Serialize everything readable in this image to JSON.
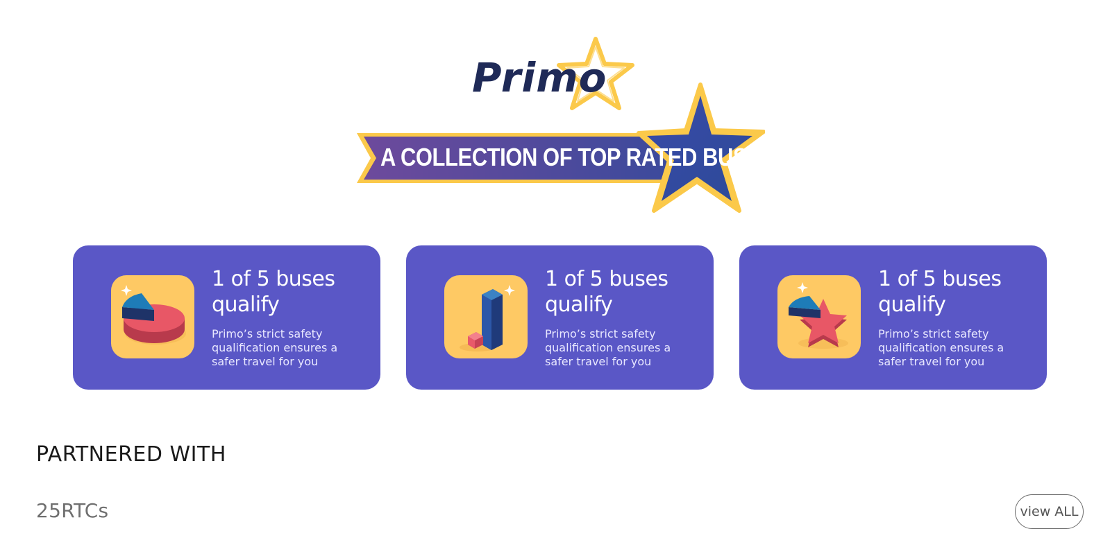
{
  "brand": {
    "logo_text": "Primo",
    "tagline": "A COLLECTION OF TOP RATED BUSES"
  },
  "colors": {
    "card_bg": "#5a57c6",
    "icon_bg": "#fec964",
    "star_gold": "#fbc94a",
    "ribbon_start": "#6d4a9c",
    "ribbon_end": "#2f4d9a",
    "logo_navy": "#1f2a57"
  },
  "cards": [
    {
      "icon": "pie-chart-icon",
      "title": "1 of 5 buses qualify",
      "description": "Primo’s strict safety qualification ensures a safer travel for you"
    },
    {
      "icon": "bar-chart-icon",
      "title": "1 of 5 buses qualify",
      "description": "Primo’s strict safety qualification ensures a safer travel for you"
    },
    {
      "icon": "star-chart-icon",
      "title": "1 of 5 buses qualify",
      "description": "Primo’s strict safety qualification ensures a safer travel for you"
    }
  ],
  "partners": {
    "heading": "PARTNERED WITH",
    "count_label": "25RTCs",
    "view_all_label": "view ALL"
  }
}
